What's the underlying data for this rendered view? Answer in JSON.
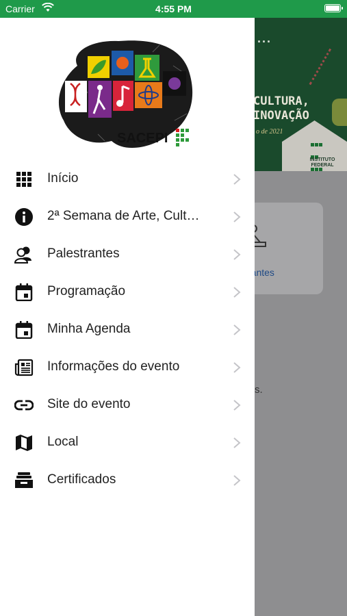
{
  "status_bar": {
    "carrier": "Carrier",
    "time": "4:55 PM"
  },
  "background_page": {
    "banner_ellipsis": "...",
    "banner_line1": "CULTURA,",
    "banner_line2": "INOVAÇÃO",
    "banner_date": "o de 2021",
    "institute_line1": "INSTITUTO",
    "institute_line2": "FEDERAL",
    "card_label": "rantes",
    "trailing_text": "s."
  },
  "drawer": {
    "logo_text": "SACEPI",
    "menu": [
      {
        "icon": "grid-icon",
        "label": "Início"
      },
      {
        "icon": "info-icon",
        "label": "2ª Semana de Arte, Cult…"
      },
      {
        "icon": "people-icon",
        "label": "Palestrantes"
      },
      {
        "icon": "calendar-icon",
        "label": "Programação"
      },
      {
        "icon": "calendar-event-icon",
        "label": "Minha Agenda"
      },
      {
        "icon": "newspaper-icon",
        "label": "Informações do evento"
      },
      {
        "icon": "link-icon",
        "label": "Site do evento"
      },
      {
        "icon": "map-icon",
        "label": "Local"
      },
      {
        "icon": "archive-icon",
        "label": "Certificados"
      }
    ]
  },
  "colors": {
    "status_bar": "#1f9a4a",
    "banner": "#1a4a2c",
    "scrim": "#8e8e90",
    "drawer": "#ffffff"
  }
}
